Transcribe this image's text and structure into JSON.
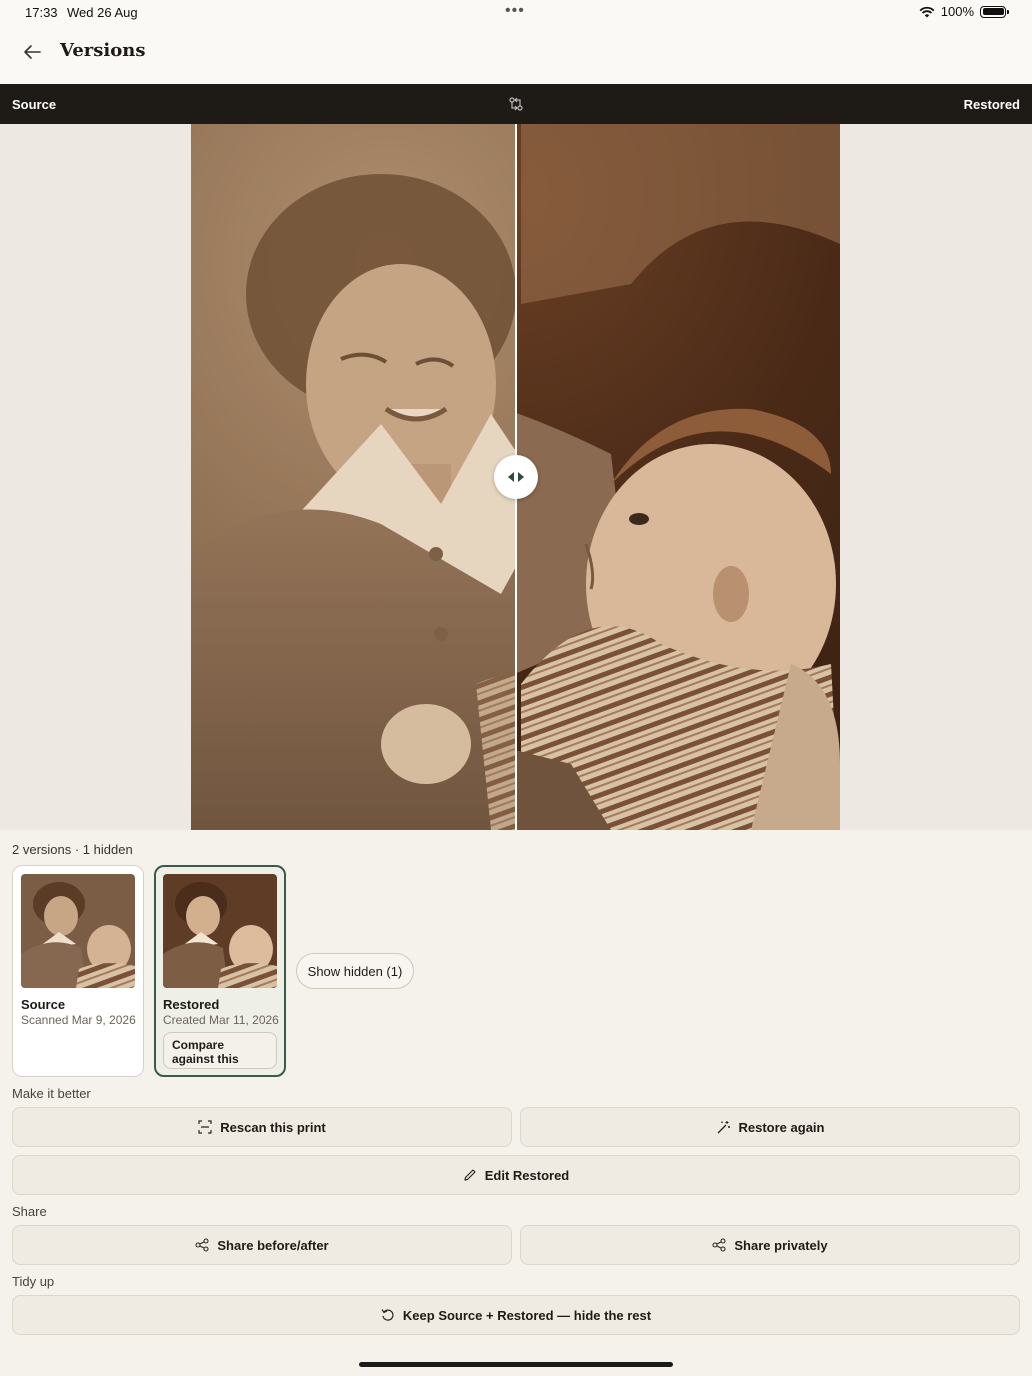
{
  "status_bar": {
    "time": "17:33",
    "date": "Wed 26 Aug",
    "dots": "•••",
    "battery": "100%"
  },
  "header": {
    "title": "Versions",
    "back_icon": "arrow-left-icon"
  },
  "compare_bar": {
    "left_label": "Source",
    "right_label": "Restored",
    "swap_icon": "swap-icon"
  },
  "versions": {
    "summary": "2 versions · 1 hidden",
    "items": [
      {
        "title": "Source",
        "subtitle": "Scanned Mar 9, 2026",
        "selected": false
      },
      {
        "title": "Restored",
        "subtitle": "Created Mar 11, 2026",
        "selected": true,
        "action_label": "Compare against this"
      }
    ],
    "show_hidden_label": "Show hidden (1)"
  },
  "make_better": {
    "label": "Make it better",
    "rescan_label": "Rescan this print",
    "restore_again_label": "Restore again",
    "edit_label": "Edit Restored"
  },
  "share": {
    "label": "Share",
    "before_after_label": "Share before/after",
    "privately_label": "Share privately"
  },
  "tidy_up": {
    "label": "Tidy up",
    "keep_label": "Keep Source + Restored — hide the rest"
  },
  "colors": {
    "accent": "#3b5a4b",
    "compare_bar_bg": "#1e1a16",
    "page_bg": "#f5f1eb"
  }
}
